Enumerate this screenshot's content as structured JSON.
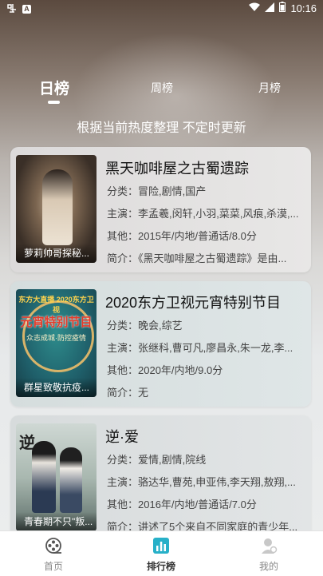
{
  "status_bar": {
    "left_icons": [
      "app-notification-icon",
      "a-notification-icon"
    ],
    "time": "10:16"
  },
  "tabs": [
    {
      "label": "日榜",
      "active": true
    },
    {
      "label": "周榜",
      "active": false
    },
    {
      "label": "月榜",
      "active": false
    }
  ],
  "subtitle": "根据当前热度整理 不定时更新",
  "items": [
    {
      "title": "黑天咖啡屋之古蜀遗踪",
      "poster_caption": "萝莉帅哥探秘...",
      "genre": "分类：冒险,剧情,国产",
      "cast": "主演：李孟羲,闵轩,小羽,菜菜,风痕,杀漠,...",
      "other": "其他：2015年/内地/普通话/8.0分",
      "summary": "简介：《黑天咖啡屋之古蜀遗踪》是由..."
    },
    {
      "title": "2020东方卫视元宵特别节目",
      "poster_caption": "群星致敬抗疫...",
      "poster_text_top": "东方大直播 2020东方卫视",
      "poster_text_main": "元宵特别节目",
      "poster_text_sub": "众志成城·防控疫情",
      "genre": "分类：晚会,综艺",
      "cast": "主演：张继科,曹可凡,廖昌永,朱一龙,李...",
      "other": "其他：2020年/内地/9.0分",
      "summary": "简介：无"
    },
    {
      "title": "逆·爱",
      "poster_caption": "青春期不只\"叛...",
      "poster_text_mark": "逆",
      "genre": "分类：爱情,剧情,院线",
      "cast": "主演：骆达华,曹苑,申亚伟,李天翔,敖翔,...",
      "other": "其他：2016年/内地/普通话/7.0分",
      "summary": "简介：讲述了5个来自不同家庭的青少年..."
    }
  ],
  "nav": [
    {
      "label": "首页",
      "icon": "film-reel-icon",
      "active": false
    },
    {
      "label": "排行榜",
      "icon": "ranking-chart-icon",
      "active": true
    },
    {
      "label": "我的",
      "icon": "user-profile-icon",
      "active": false
    }
  ],
  "colors": {
    "active_tab": "#ffffff",
    "nav_active_icon": "#27b0c8",
    "nav_inactive": "#888888"
  }
}
